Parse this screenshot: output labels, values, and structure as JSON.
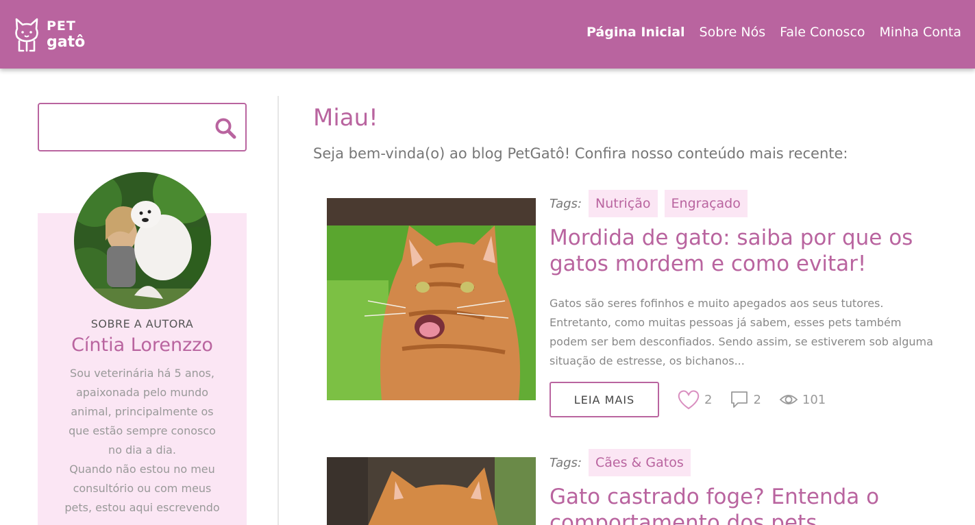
{
  "brand": {
    "line1": "PET",
    "line2": "gatô"
  },
  "nav": [
    {
      "label": "Página Inicial",
      "active": true
    },
    {
      "label": "Sobre Nós",
      "active": false
    },
    {
      "label": "Fale Conosco",
      "active": false
    },
    {
      "label": "Minha Conta",
      "active": false
    }
  ],
  "search": {
    "placeholder": "",
    "value": ""
  },
  "author": {
    "section_label": "SOBRE A AUTORA",
    "name": "Cíntia Lorenzzo",
    "bio": "Sou veterinária há 5 anos,\napaixonada pelo mundo\nanimal, principalmente os\nque estão sempre conosco\nno dia a dia.\nQuando não estou no meu\nconsultório ou com meus\npets, estou aqui escrevendo"
  },
  "main": {
    "title": "Miau!",
    "subtitle": "Seja bem-vinda(o) ao blog PetGatô! Confira nosso conteúdo mais recente:"
  },
  "posts": [
    {
      "tags_label": "Tags:",
      "tags": [
        "Nutrição",
        "Engraçado"
      ],
      "title": "Mordida de gato: saiba por que os gatos mordem e como evitar!",
      "excerpt": "Gatos são seres fofinhos e muito apegados aos seus tutores. Entretanto, como muitas pessoas já sabem, esses pets também podem ser bem desconfiados. Sendo assim, se estiverem sob alguma situação de estresse, os bichanos...",
      "read_more": "LEIA MAIS",
      "likes": "2",
      "comments": "2",
      "views": "101"
    },
    {
      "tags_label": "Tags:",
      "tags": [
        "Cães & Gatos"
      ],
      "title": "Gato castrado foge? Entenda o comportamento dos pets"
    }
  ],
  "colors": {
    "brand": "#b9649f",
    "tag_bg": "#fbe6f4"
  }
}
